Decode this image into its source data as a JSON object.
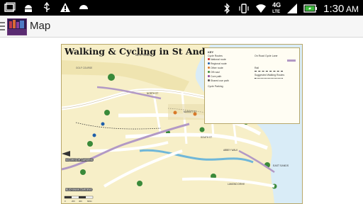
{
  "status_bar": {
    "time": "1:30",
    "time_suffix": "AM",
    "network": "4G",
    "network_sub": "LTE",
    "battery_color": "#3cba3c"
  },
  "app_bar": {
    "title": "Map",
    "logo_text": "ITS@ USTR"
  },
  "map": {
    "title": "Walking & Cycling in St Andrews",
    "key": {
      "title": "KEY",
      "cycle_routes_label": "Cycle Routes",
      "items": [
        "National route",
        "Regional route",
        "Other route",
        "Off road",
        "Core path",
        "Shared use path"
      ],
      "on_road_lane": "On Road Cycle Lane",
      "rail": "Rail",
      "suggested_walking_routes": "Suggested Walking Routes",
      "icons_label": "Cycle Parking"
    },
    "places": [
      "WEST SANDS",
      "EAST SANDS",
      "MARKET ST",
      "NORTH ST",
      "SOUTH ST",
      "ABBEY WALK",
      "LAMOND DRIVE",
      "MCGREGOR GARDENS",
      "BUCHANAN GARDENS",
      "GOLF COURSE"
    ],
    "scale": [
      "0",
      "200",
      "400",
      "600m"
    ],
    "colors": {
      "land": "#f7efc8",
      "sea": "#d9ecf7",
      "road": "#ffffff",
      "cycle_route": "#b299c5",
      "green": "#3a8a3a",
      "water": "#6fb7d9"
    }
  }
}
